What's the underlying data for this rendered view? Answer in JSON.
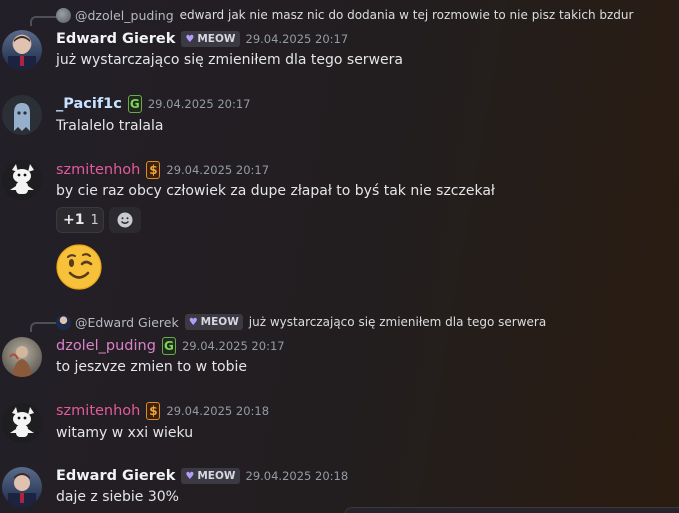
{
  "colors": {
    "edward_name": "#f2f3f5",
    "pacific_name": "#c7e3ff",
    "szmitenhoh_name": "#e35b9a",
    "dzolel_name": "#d982c8",
    "meow_heart": "#b49cff"
  },
  "messages": [
    {
      "reply": {
        "author": "@dzolel_puding",
        "text": "edward jak nie masz nic do dodania w tej rozmowie to nie pisz takich bzdur"
      },
      "author": "Edward Gierek",
      "tag": "MEOW",
      "timestamp": "29.04.2025 20:17",
      "content": "już wystarczająco się zmieniłem dla tego serwera"
    },
    {
      "author": "_Pacif1c",
      "tag": "G",
      "timestamp": "29.04.2025 20:17",
      "content": "Tralalelo tralala"
    },
    {
      "author": "szmitenhoh",
      "tag": "$",
      "timestamp": "29.04.2025 20:17",
      "content": "by cie raz obcy człowiek za dupe złapał to byś tak nie szczekał",
      "reaction": {
        "emoji": "+1",
        "count": "1"
      },
      "sticker": "winking-face-emoji"
    },
    {
      "reply": {
        "author": "@Edward Gierek",
        "tag": "MEOW",
        "text": "już wystarczająco się zmieniłem dla tego serwera"
      },
      "author": "dzolel_puding",
      "tag": "G",
      "timestamp": "29.04.2025 20:17",
      "content": "to jeszvze zmien to w tobie"
    },
    {
      "author": "szmitenhoh",
      "tag": "$",
      "timestamp": "29.04.2025 20:18",
      "content": "witamy w xxi wieku"
    },
    {
      "author": "Edward Gierek",
      "tag": "MEOW",
      "timestamp": "29.04.2025 20:18",
      "content": "daje z siebie 30%"
    }
  ]
}
